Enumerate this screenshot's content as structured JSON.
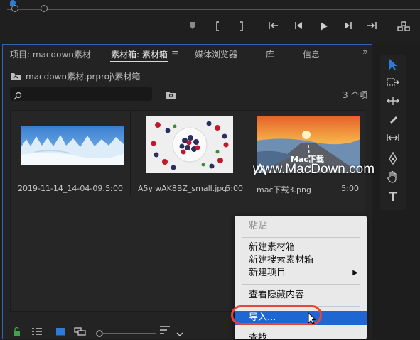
{
  "colors": {
    "accent": "#2e7bd6",
    "panel_border": "#2a67b8",
    "menu_highlight": "#1e66d2",
    "callout": "#e8443a"
  },
  "monitor": {
    "icons": [
      "marker-icon",
      "mark-in-icon",
      "mark-out-icon",
      "go-to-in-icon",
      "step-back-icon",
      "play-icon",
      "step-forward-icon",
      "go-to-out-icon",
      "button-editor-icon"
    ]
  },
  "tabs": [
    {
      "label": "项目: macdown素材"
    },
    {
      "label": "素材箱: 素材箱"
    },
    {
      "label": "媒体浏览器"
    },
    {
      "label": "库"
    },
    {
      "label": "信息"
    }
  ],
  "tab_overflow": "»",
  "menu_icon": "≡",
  "path": "macdown素材.prproj\\素材箱",
  "search": {
    "placeholder": ""
  },
  "items_count": "3 个项",
  "items": [
    {
      "name": "2019-11-14_14-04-09....",
      "duration": "5:00"
    },
    {
      "name": "A5yjwAK8BZ_small.jpg",
      "duration": "5:00"
    },
    {
      "name": "mac下载3.png",
      "duration": "5:00"
    }
  ],
  "thumb3_overlay": "Mac下载",
  "watermark": "www.MacDown.com",
  "context_menu": {
    "paste": "粘贴",
    "new_bin": "新建素材箱",
    "new_search_bin": "新建搜索素材箱",
    "new_item": "新建项目",
    "submenu_arrow": "▶",
    "view_hidden": "查看隐藏内容",
    "import": "导入...",
    "find": "查找..."
  },
  "tools": [
    "selection-tool-icon",
    "track-select-tool-icon",
    "ripple-edit-tool-icon",
    "razor-tool-icon",
    "slip-tool-icon",
    "pen-tool-icon",
    "hand-tool-icon",
    "type-tool-icon"
  ],
  "type_tool_glyph": "T"
}
